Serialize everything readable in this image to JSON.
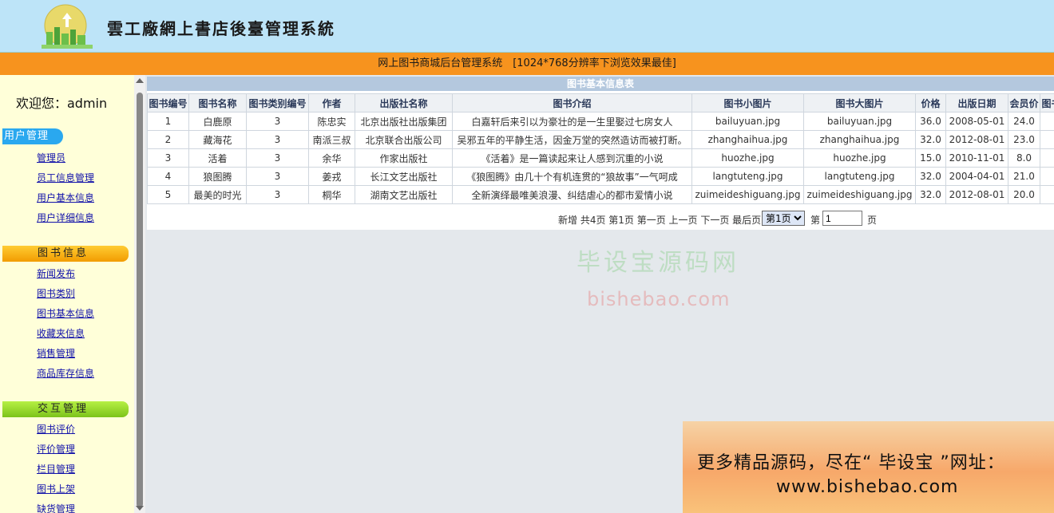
{
  "header": {
    "site_title": "雲工廠網上書店後臺管理系統",
    "banner_text": "网上图书商城后台管理系统　[1024*768分辨率下浏览效果最佳]"
  },
  "sidebar": {
    "welcome": "欢迎您：admin",
    "groups": [
      {
        "title": "用户管理",
        "items": [
          "管理员",
          "员工信息管理",
          "用户基本信息",
          "用户详细信息"
        ]
      },
      {
        "title": "图书信息",
        "items": [
          "新闻发布",
          "图书类别",
          "图书基本信息",
          "收藏夹信息",
          "销售管理",
          "商品库存信息"
        ]
      },
      {
        "title": "交互管理",
        "items": [
          "图书评价",
          "评价管理",
          "栏目管理",
          "图书上架",
          "缺货管理"
        ]
      }
    ]
  },
  "main": {
    "panel_title": "图书基本信息表",
    "columns": [
      "图书编号",
      "图书名称",
      "图书类别编号",
      "作者",
      "出版社名称",
      "图书介绍",
      "图书小图片",
      "图书大图片",
      "价格",
      "出版日期",
      "会员价",
      "图书"
    ],
    "rows": [
      [
        "1",
        "白鹿原",
        "3",
        "陈忠实",
        "北京出版社出版集团",
        "白嘉轩后来引以为豪壮的是一生里娶过七房女人",
        "bailuyuan.jpg",
        "bailuyuan.jpg",
        "36.0",
        "2008-05-01",
        "24.0",
        ""
      ],
      [
        "2",
        "藏海花",
        "3",
        "南派三叔",
        "北京联合出版公司",
        "吴邪五年的平静生活，因金万堂的突然造访而被打断。",
        "zhanghaihua.jpg",
        "zhanghaihua.jpg",
        "32.0",
        "2012-08-01",
        "23.0",
        ""
      ],
      [
        "3",
        "活着",
        "3",
        "余华",
        "作家出版社",
        "《活着》是一篇读起来让人感到沉重的小说",
        "huozhe.jpg",
        "huozhe.jpg",
        "15.0",
        "2010-11-01",
        "8.0",
        ""
      ],
      [
        "4",
        "狼图腾",
        "3",
        "姜戎",
        "长江文艺出版社",
        "《狼图腾》由几十个有机连贯的“狼故事”一气呵成",
        "langtuteng.jpg",
        "langtuteng.jpg",
        "32.0",
        "2004-04-01",
        "21.0",
        ""
      ],
      [
        "5",
        "最美的时光",
        "3",
        "桐华",
        "湖南文艺出版社",
        "全新演绎最唯美浪漫、纠结虐心的都市爱情小说",
        "zuimeideshiguang.jpg",
        "zuimeideshiguang.jpg",
        "32.0",
        "2012-08-01",
        "20.0",
        ""
      ]
    ],
    "pager": {
      "text": "新增 共4页 第1页 第一页 上一页 下一页 最后页",
      "page_select": "第1页",
      "label_before": "第",
      "page_input": "1",
      "label_after": "页"
    }
  },
  "watermarks": {
    "cn": "毕设宝源码网",
    "url": "bishebao.com"
  },
  "ad": {
    "line1": "更多精品源码，尽在“ 毕设宝 ”网址：",
    "line2": "www.bishebao.com"
  }
}
